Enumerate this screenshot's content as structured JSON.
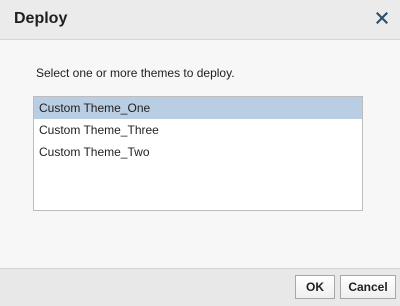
{
  "dialog": {
    "title": "Deploy",
    "close_icon": "close-x-icon",
    "instruction": "Select one or more themes to deploy.",
    "themes": [
      {
        "label": "Custom Theme_One",
        "selected": true
      },
      {
        "label": "Custom Theme_Three",
        "selected": false
      },
      {
        "label": "Custom Theme_Two",
        "selected": false
      }
    ],
    "buttons": {
      "ok": "OK",
      "cancel": "Cancel"
    }
  },
  "colors": {
    "selection": "#b9cee2",
    "close_icon": "#2f4f6f"
  }
}
